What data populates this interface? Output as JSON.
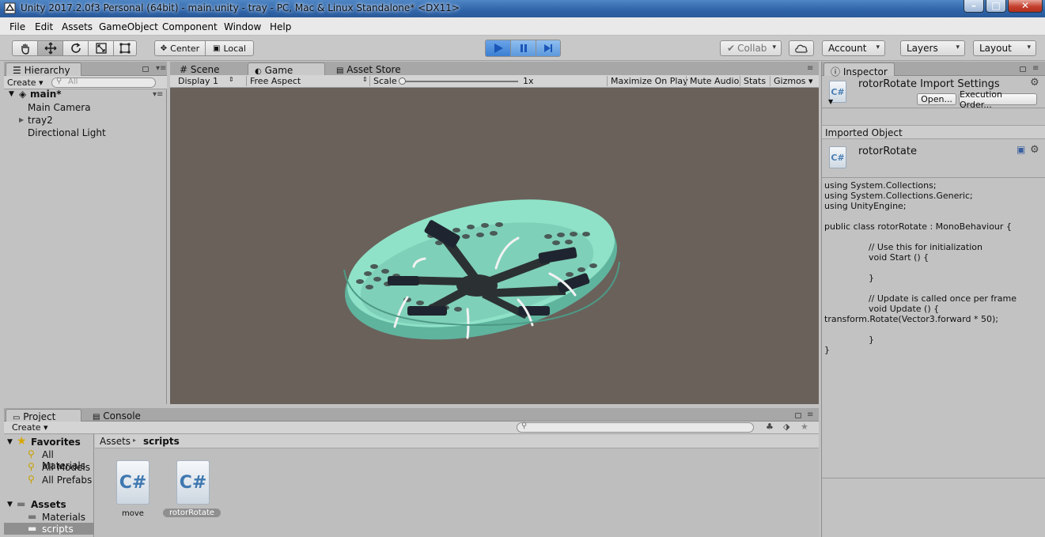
{
  "window": {
    "title": "Unity 2017.2.0f3 Personal (64bit) - main.unity - tray - PC, Mac & Linux Standalone* <DX11>"
  },
  "menu": {
    "items": [
      "File",
      "Edit",
      "Assets",
      "GameObject",
      "Component",
      "Window",
      "Help"
    ]
  },
  "toolbar": {
    "pivot_label": "Center",
    "space_label": "Local",
    "collab_label": "Collab",
    "account_label": "Account",
    "layers_label": "Layers",
    "layout_label": "Layout"
  },
  "hierarchy": {
    "tab_label": "Hierarchy",
    "create_label": "Create",
    "search_placeholder": "All",
    "scene_name": "main*",
    "items": [
      "Main Camera",
      "tray2",
      "Directional Light"
    ]
  },
  "center_tabs": {
    "scene": "Scene",
    "game": "Game",
    "asset_store": "Asset Store"
  },
  "game_bar": {
    "display": "Display 1",
    "aspect": "Free Aspect",
    "scale_label": "Scale",
    "scale_value": "1x",
    "maximize": "Maximize On Play",
    "mute": "Mute Audio",
    "stats": "Stats",
    "gizmos": "Gizmos"
  },
  "project": {
    "tab_project": "Project",
    "tab_console": "Console",
    "create_label": "Create",
    "favorites_label": "Favorites",
    "favorites": [
      "All Materials",
      "All Models",
      "All Prefabs"
    ],
    "assets_label": "Assets",
    "folders": [
      "Materials",
      "scripts"
    ],
    "breadcrumb": [
      "Assets",
      "scripts"
    ],
    "files": [
      "move",
      "rotorRotate"
    ]
  },
  "inspector": {
    "tab_label": "Inspector",
    "header_title": "rotorRotate Import Settings",
    "open_button": "Open...",
    "exec_order_button": "Execution Order...",
    "imported_object_label": "Imported Object",
    "asset_name": "rotorRotate",
    "code": "using System.Collections;\nusing System.Collections.Generic;\nusing UnityEngine;\n\npublic class rotorRotate : MonoBehaviour {\n\n\t\t// Use this for initialization\n\t\tvoid Start () {\n\n\t\t}\n\n\t\t// Update is called once per frame\n\t\tvoid Update () {\ntransform.Rotate(Vector3.forward * 50);\n\n\t\t}\n}"
  },
  "colors": {
    "game_background": "#6a615b",
    "tray_color": "#8fe2c8",
    "play_active": "#4a8fe0"
  }
}
